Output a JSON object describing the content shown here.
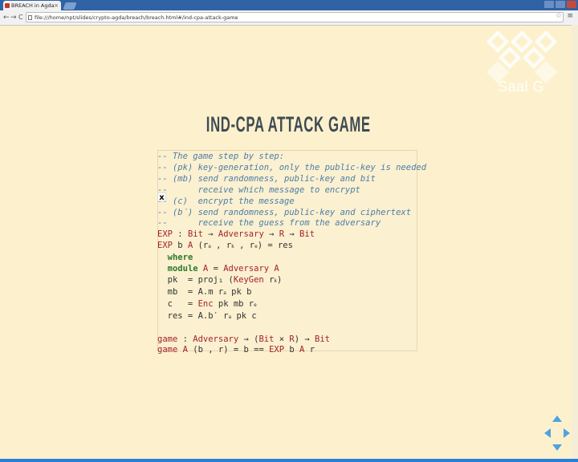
{
  "browser": {
    "tab_title": "BREACH in Agda",
    "tab_close": "×",
    "url": "file:///home/npt/slides/crypto-agda/breach/breach.html#/ind-cpa-attack-game",
    "back": "←",
    "forward": "→",
    "reload": "C",
    "star": "☆",
    "menu": "≡"
  },
  "watermark": {
    "text": "Saal G"
  },
  "slide": {
    "title": "IND-CPA ATTACK GAME",
    "cursor_mark": "x",
    "code_lines": [
      [
        {
          "c": "comment",
          "t": "-- The game step by step:"
        }
      ],
      [
        {
          "c": "comment",
          "t": "-- (pk) key-generation, only the public-key is needed"
        }
      ],
      [
        {
          "c": "comment",
          "t": "-- (mb) send randomness, public-key and bit"
        }
      ],
      [
        {
          "c": "comment",
          "t": "--      receive which message to encrypt"
        }
      ],
      [
        {
          "c": "comment",
          "t": "-- (c)  encrypt the message"
        }
      ],
      [
        {
          "c": "comment",
          "t": "-- (b′) send randomness, public-key and ciphertext"
        }
      ],
      [
        {
          "c": "comment",
          "t": "--      receive the guess from the adversary"
        }
      ],
      [
        {
          "c": "fn",
          "t": "EXP"
        },
        {
          "c": "",
          "t": " : "
        },
        {
          "c": "ty",
          "t": "Bit"
        },
        {
          "c": "",
          "t": " → "
        },
        {
          "c": "ty",
          "t": "Adversary"
        },
        {
          "c": "",
          "t": " → "
        },
        {
          "c": "ty",
          "t": "R"
        },
        {
          "c": "",
          "t": " → "
        },
        {
          "c": "ty",
          "t": "Bit"
        }
      ],
      [
        {
          "c": "fn",
          "t": "EXP"
        },
        {
          "c": "",
          "t": " b "
        },
        {
          "c": "ty",
          "t": "A"
        },
        {
          "c": "",
          "t": " (r"
        },
        {
          "c": "sub",
          "t": "a"
        },
        {
          "c": "",
          "t": " , r"
        },
        {
          "c": "sub",
          "t": "k"
        },
        {
          "c": "",
          "t": " , r"
        },
        {
          "c": "sub",
          "t": "e"
        },
        {
          "c": "",
          "t": ") = res"
        }
      ],
      [
        {
          "c": "",
          "t": "  "
        },
        {
          "c": "kw",
          "t": "where"
        }
      ],
      [
        {
          "c": "",
          "t": "  "
        },
        {
          "c": "kw",
          "t": "module"
        },
        {
          "c": "",
          "t": " "
        },
        {
          "c": "ty",
          "t": "A"
        },
        {
          "c": "",
          "t": " = "
        },
        {
          "c": "ty",
          "t": "Adversary A"
        }
      ],
      [
        {
          "c": "",
          "t": "  pk  = proj₁ ("
        },
        {
          "c": "fn",
          "t": "KeyGen"
        },
        {
          "c": "",
          "t": " r"
        },
        {
          "c": "sub",
          "t": "k"
        },
        {
          "c": "",
          "t": ")"
        }
      ],
      [
        {
          "c": "",
          "t": "  mb  = A.m r"
        },
        {
          "c": "sub",
          "t": "a"
        },
        {
          "c": "",
          "t": " pk b"
        }
      ],
      [
        {
          "c": "",
          "t": "  c   = "
        },
        {
          "c": "fn",
          "t": "Enc"
        },
        {
          "c": "",
          "t": " pk mb r"
        },
        {
          "c": "sub",
          "t": "e"
        }
      ],
      [
        {
          "c": "",
          "t": "  res = A.b′ r"
        },
        {
          "c": "sub",
          "t": "a"
        },
        {
          "c": "",
          "t": " pk c"
        }
      ],
      [
        {
          "c": "",
          "t": " "
        }
      ],
      [
        {
          "c": "fn",
          "t": "game"
        },
        {
          "c": "",
          "t": " : "
        },
        {
          "c": "ty",
          "t": "Adversary"
        },
        {
          "c": "",
          "t": " → ("
        },
        {
          "c": "ty",
          "t": "Bit"
        },
        {
          "c": "",
          "t": " × "
        },
        {
          "c": "ty",
          "t": "R"
        },
        {
          "c": "",
          "t": ") → "
        },
        {
          "c": "ty",
          "t": "Bit"
        }
      ],
      [
        {
          "c": "fn",
          "t": "game"
        },
        {
          "c": "",
          "t": " "
        },
        {
          "c": "ty",
          "t": "A"
        },
        {
          "c": "",
          "t": " (b , r) = b == "
        },
        {
          "c": "fn",
          "t": "EXP"
        },
        {
          "c": "",
          "t": " b "
        },
        {
          "c": "ty",
          "t": "A"
        },
        {
          "c": "",
          "t": " r"
        }
      ]
    ]
  },
  "colors": {
    "background": "#fdf1cd",
    "title": "#3e4c53",
    "comment": "#4b7ea8",
    "keyword": "#2c7a2c",
    "identifier": "#a3232c",
    "nav_arrow": "#4fa3e0"
  }
}
